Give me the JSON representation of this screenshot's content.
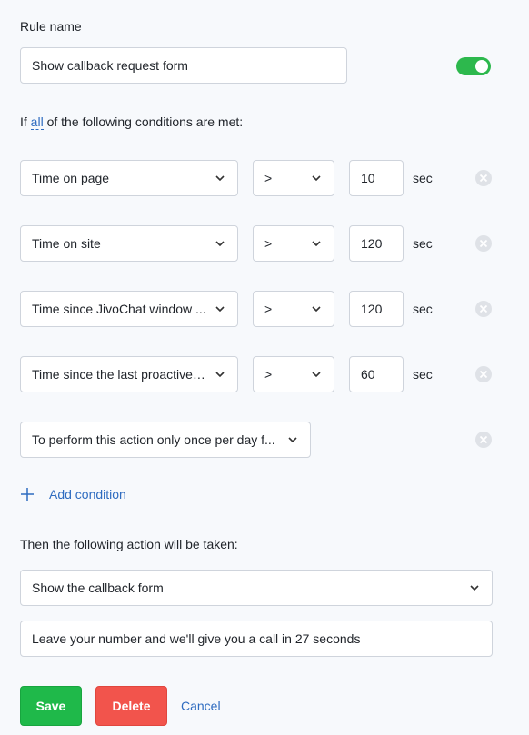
{
  "rule": {
    "name_label": "Rule name",
    "name_value": "Show callback request form",
    "enabled": true
  },
  "conditions_header": {
    "prefix": "If",
    "mode": "all",
    "suffix": "of the following conditions are met:"
  },
  "conditions": [
    {
      "field": "Time on page",
      "operator": ">",
      "value": "10",
      "unit": "sec"
    },
    {
      "field": "Time on site",
      "operator": ">",
      "value": "120",
      "unit": "sec"
    },
    {
      "field": "Time since JivoChat window ...",
      "operator": ">",
      "value": "120",
      "unit": "sec"
    },
    {
      "field": "Time since the last proactive i...",
      "operator": ">",
      "value": "60",
      "unit": "sec"
    },
    {
      "field": "To perform this action only once per day f..."
    }
  ],
  "add_condition_label": "Add condition",
  "action": {
    "header": "Then the following action will be taken:",
    "type": "Show the callback form",
    "message": "Leave your number and we'll give you a call in 27 seconds"
  },
  "buttons": {
    "save": "Save",
    "delete": "Delete",
    "cancel": "Cancel"
  },
  "colors": {
    "accent": "#2f6cc0",
    "save": "#1fb94a",
    "delete": "#f2544c",
    "toggle_on": "#2db84d"
  },
  "icons": {
    "chevron": "chevron-down-icon",
    "remove": "remove-circle-icon",
    "add": "plus-icon"
  }
}
